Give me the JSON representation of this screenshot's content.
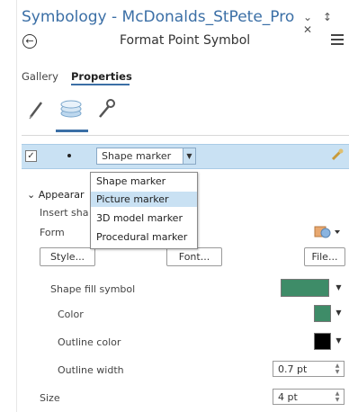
{
  "window": {
    "title": "Symbology - McDonalds_StPete_Pro",
    "controls": "⌄ ↕ ✕"
  },
  "header": {
    "subtitle": "Format Point Symbol"
  },
  "tabs": [
    {
      "label": "Gallery"
    },
    {
      "label": "Properties"
    }
  ],
  "layer": {
    "checked": true,
    "symbol_type": "Shape marker"
  },
  "dropdown_options": [
    "Shape marker",
    "Picture marker",
    "3D model marker",
    "Procedural marker"
  ],
  "dropdown_highlighted": "Picture marker",
  "appearance": {
    "section_label": "Appearar",
    "insert_label": "Insert sha",
    "form_label": "Form",
    "style_button": "Style...",
    "font_button": "Font...",
    "file_button": "File...",
    "shape_fill_label": "Shape fill symbol",
    "shape_fill_color": "#3e8c68",
    "color_label": "Color",
    "color_value": "#3e8c68",
    "outline_color_label": "Outline color",
    "outline_color_value": "#000000",
    "outline_width_label": "Outline width",
    "outline_width_value": "0.7 pt",
    "size_label": "Size",
    "size_value": "4 pt"
  },
  "colors": {
    "accent": "#3b6fa6",
    "row_highlight": "#c9e1f3"
  }
}
